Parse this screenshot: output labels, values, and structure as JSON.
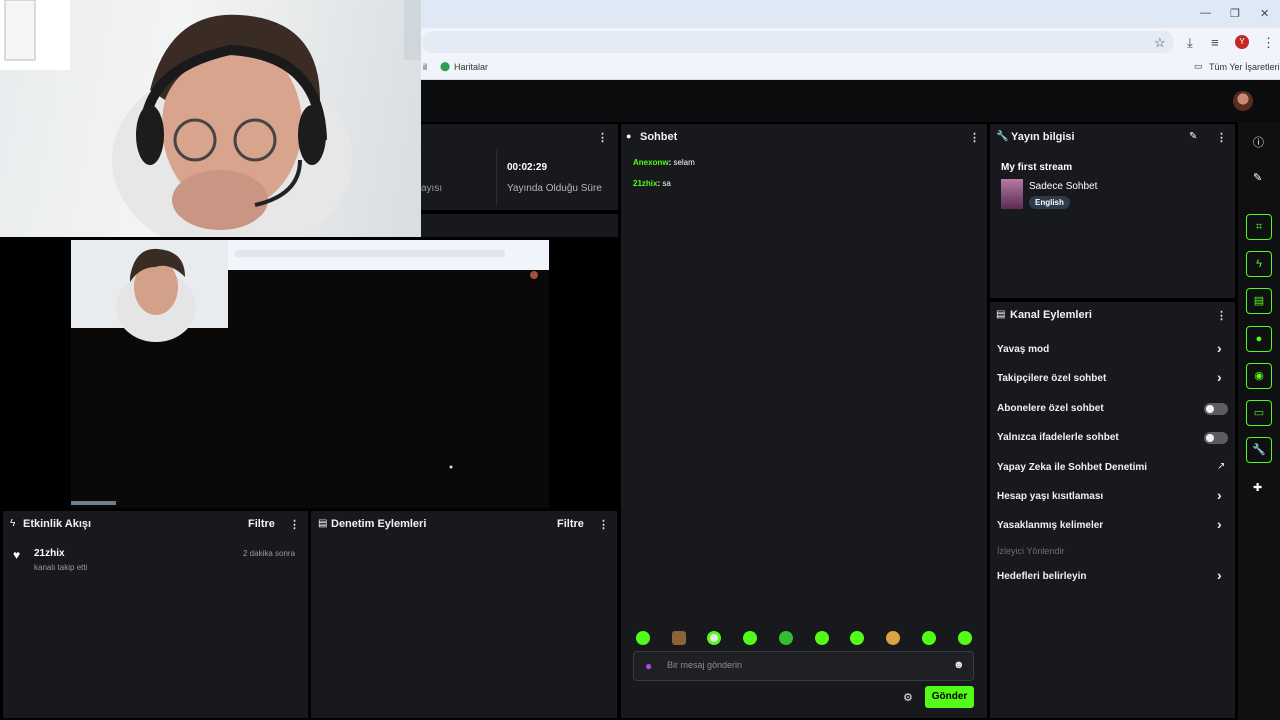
{
  "browser": {
    "bookmarks": [
      {
        "label": "il"
      },
      {
        "label": "Haritalar"
      }
    ],
    "all_bookmarks_label": "Tüm Yer İşaretleri",
    "profile_initial": "Y"
  },
  "stats": {
    "partial_label": "ayısı",
    "duration_value": "00:02:29",
    "duration_label": "Yayında Olduğu Süre"
  },
  "chat": {
    "title": "Sohbet",
    "messages": [
      {
        "user": "Anexonw",
        "text": "selam"
      },
      {
        "user": "21zhix",
        "text": "sa"
      }
    ],
    "input_placeholder": "Bir mesaj gönderin",
    "send_label": "Gönder"
  },
  "stream_info": {
    "title": "Yayın bilgisi",
    "stream_title": "My first stream",
    "category": "Sadece Sohbet",
    "language_tag": "English"
  },
  "channel_actions": {
    "title": "Kanal Eylemleri",
    "items": [
      {
        "label": "Yavaş mod",
        "control": "chevron"
      },
      {
        "label": "Takipçilere özel sohbet",
        "control": "chevron"
      },
      {
        "label": "Abonelere özel sohbet",
        "control": "toggle"
      },
      {
        "label": "Yalnızca ifadelerle sohbet",
        "control": "toggle"
      },
      {
        "label": "Yapay Zeka ile Sohbet Denetimi",
        "control": "external"
      },
      {
        "label": "Hesap yaşı kısıtlaması",
        "control": "chevron"
      },
      {
        "label": "Yasaklanmış kelimeler",
        "control": "chevron"
      }
    ],
    "section_label": "İzleyici Yönlendir",
    "target_label": "Hedefleri belirleyin"
  },
  "activity_feed": {
    "title": "Etkinlik Akışı",
    "filter_label": "Filtre",
    "events": [
      {
        "user": "21zhix",
        "time": "2 dakika sonra",
        "description": "kanalı takip etti"
      }
    ]
  },
  "moderation": {
    "title": "Denetim Eylemleri",
    "filter_label": "Filtre"
  },
  "colors": {
    "accent": "#53fc18",
    "panel": "#18191c",
    "background": "#000000"
  }
}
